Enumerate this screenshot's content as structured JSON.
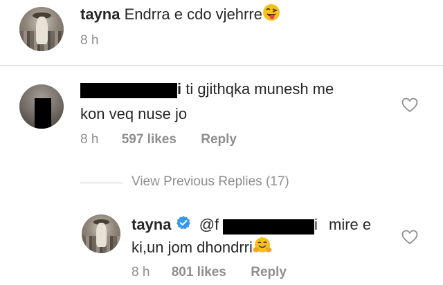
{
  "post_caption": {
    "username": "tayna",
    "text": "Endrra e cdo vjehrre",
    "emoji_icon": "tongue-wink-emoji-icon",
    "time": "8 h"
  },
  "comment": {
    "username_suffix": "i",
    "text_line1": "ti gjithqka munesh me",
    "text_line2": "kon veq nuse jo",
    "time": "8 h",
    "likes": "597 likes",
    "reply_label": "Reply",
    "heart_icon": "heart-outline-icon"
  },
  "view_previous": "View Previous Replies (17)",
  "reply": {
    "username": "tayna",
    "verified_icon": "verified-badge-icon",
    "mention_prefix": "@f",
    "mention_suffix": "i",
    "text_line1": "mire e",
    "text_line2": "ki,un jom dhondrri",
    "emoji_icon": "hugging-emoji-icon",
    "time": "8 h",
    "likes": "801 likes",
    "reply_label": "Reply",
    "heart_icon": "heart-outline-icon"
  },
  "colors": {
    "text": "#262626",
    "muted": "#8e8e8e",
    "verified": "#3897f0",
    "divider": "#dbdbdb"
  }
}
